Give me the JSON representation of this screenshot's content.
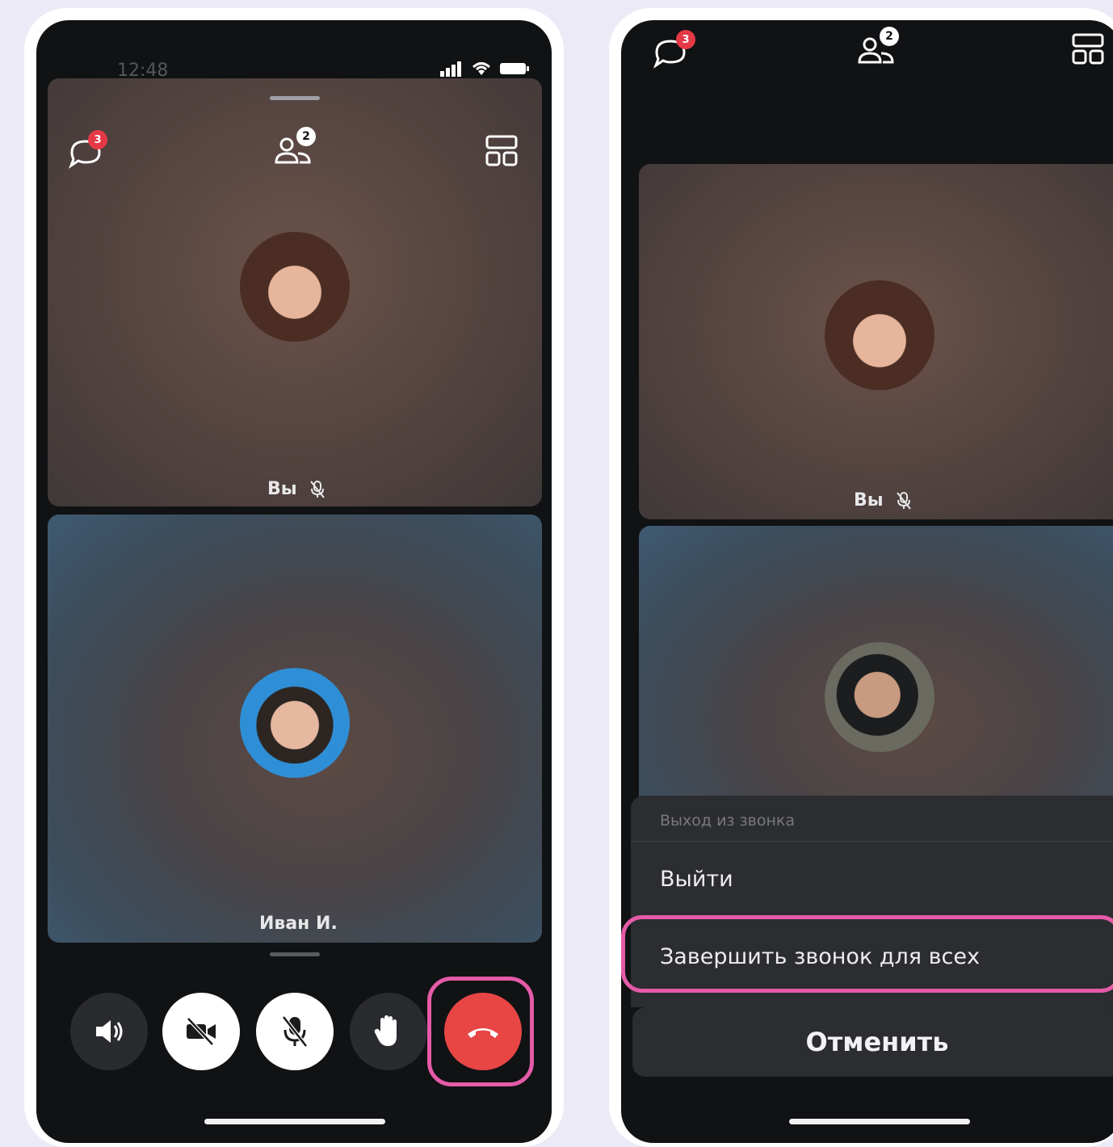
{
  "left_phone": {
    "status_time": "12:48",
    "chat_badge": "3",
    "participants_badge": "2",
    "tiles": [
      {
        "label": "Вы"
      },
      {
        "label": "Иван И."
      }
    ],
    "controls": [
      "speaker-icon",
      "camera-off-icon",
      "mic-off-icon",
      "raise-hand-icon",
      "hang-up-icon"
    ]
  },
  "right_phone": {
    "chat_badge": "3",
    "participants_badge": "2",
    "tiles": [
      {
        "label": "Вы"
      }
    ],
    "sheet": {
      "title": "Выход из звонка",
      "leave": "Выйти",
      "end_for_all": "Завершить звонок для всех",
      "cancel": "Отменить"
    }
  },
  "colors": {
    "background": "#ECEAF7",
    "highlight": "#E45BA8",
    "hangup": "#E84545",
    "badge": "#E63946"
  }
}
